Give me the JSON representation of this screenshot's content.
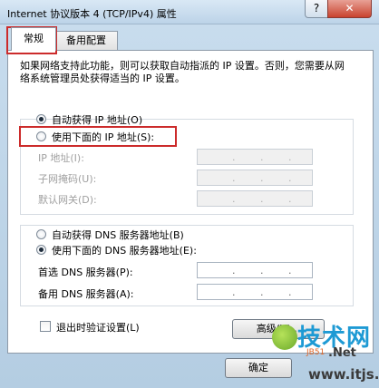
{
  "window": {
    "title": "Internet 协议版本 4 (TCP/IPv4) 属性",
    "help_glyph": "?",
    "close_glyph": "✕"
  },
  "tabs": [
    {
      "label": "常规",
      "active": true
    },
    {
      "label": "备用配置",
      "active": false
    }
  ],
  "description": "如果网络支持此功能，则可以获取自动指派的 IP 设置。否则，您需要从网络系统管理员处获得适当的 IP 设置。",
  "ip_group": {
    "auto_label": "自动获得 IP 地址(O)",
    "manual_label": "使用下面的 IP 地址(S):",
    "selected": "auto",
    "fields": [
      {
        "label": "IP 地址(I):",
        "dots": "."
      },
      {
        "label": "子网掩码(U):",
        "dots": "."
      },
      {
        "label": "默认网关(D):",
        "dots": "."
      }
    ]
  },
  "dns_group": {
    "auto_label": "自动获得 DNS 服务器地址(B)",
    "manual_label": "使用下面的 DNS 服务器地址(E):",
    "selected": "manual",
    "fields": [
      {
        "label": "首选 DNS 服务器(P):",
        "dots": "."
      },
      {
        "label": "备用 DNS 服务器(A):",
        "dots": "."
      }
    ]
  },
  "validate_label": "退出时验证设置(L)",
  "advanced_label": "高级(V)...",
  "ok_label": "确定",
  "watermark": {
    "cn": "技术网",
    "jb": "JB51",
    "net": ".Net",
    "url": "www.itjs.cn"
  },
  "colors": {
    "highlight": "#cc2b2b",
    "close_button": "#c9432f"
  }
}
